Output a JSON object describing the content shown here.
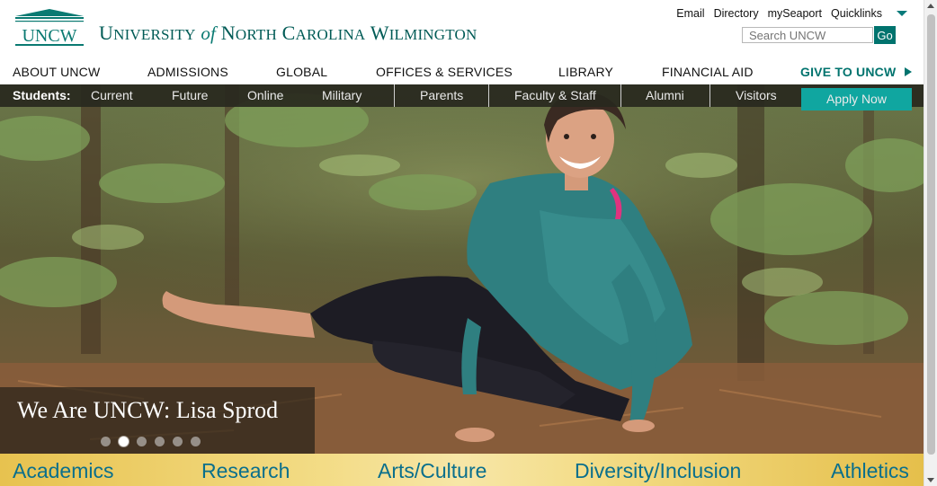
{
  "header": {
    "logo_text": "UNCW",
    "title_parts": [
      "U",
      "NIVERSITY",
      "of",
      "N",
      "ORTH",
      "C",
      "AROLINA",
      "W",
      "ILMINGTON"
    ],
    "brand_color": "#005b56"
  },
  "utility": {
    "links": [
      "Email",
      "Directory",
      "mySeaport",
      "Quicklinks"
    ],
    "quicklinks_icon": "caret-down-icon",
    "search_placeholder": "Search UNCW",
    "search_button": "Go"
  },
  "mainnav": {
    "items": [
      "ABOUT UNCW",
      "ADMISSIONS",
      "GLOBAL",
      "OFFICES & SERVICES",
      "LIBRARY",
      "FINANCIAL AID"
    ],
    "give": "GIVE TO UNCW",
    "give_icon": "arrow-right-icon"
  },
  "audience": {
    "label": "Students:",
    "student_links": [
      "Current",
      "Future",
      "Online",
      "Military"
    ],
    "other_links": [
      "Parents",
      "Faculty & Staff",
      "Alumni",
      "Visitors"
    ],
    "apply": "Apply Now",
    "apply_color": "#10a6a0"
  },
  "hero": {
    "caption": "We Are UNCW: Lisa Sprod",
    "slide_count": 6,
    "active_slide": 2
  },
  "bottombar": {
    "links": [
      "Academics",
      "Research",
      "Arts/Culture",
      "Diversity/Inclusion",
      "Athletics"
    ],
    "link_color": "#0a6f8c"
  }
}
